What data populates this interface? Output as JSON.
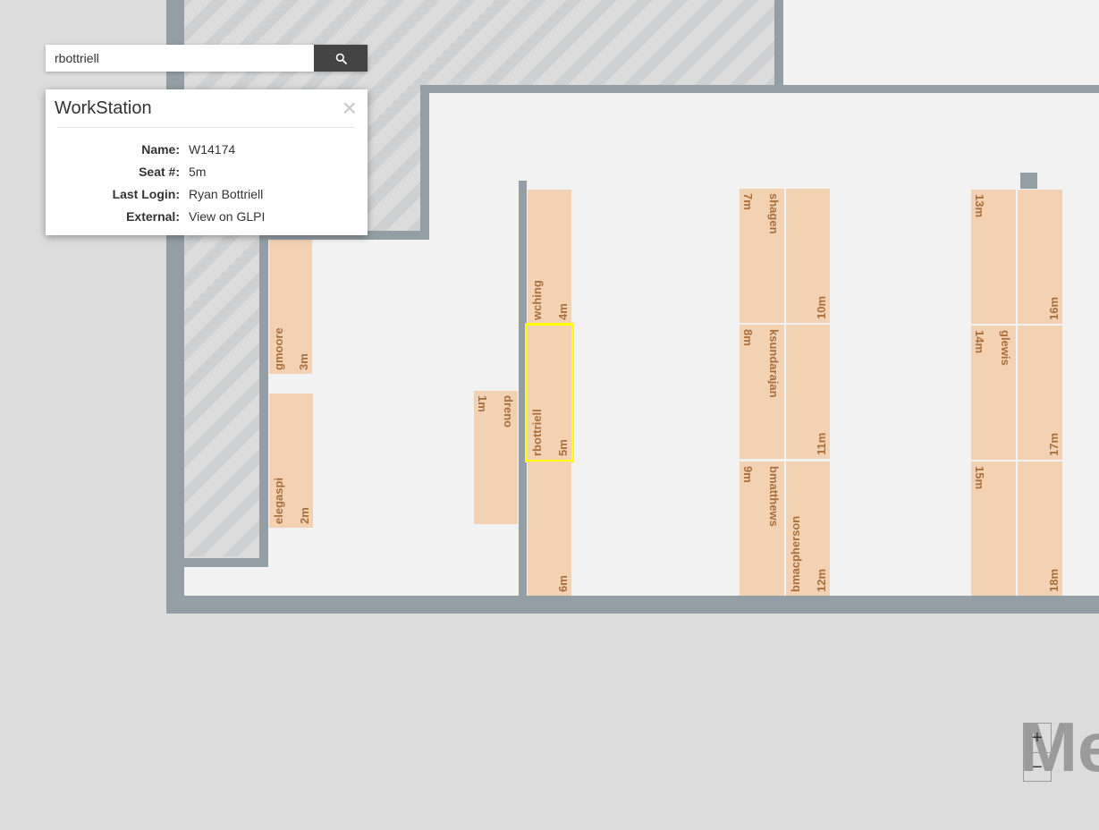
{
  "search": {
    "value": "rbottriell",
    "icon": "search-icon"
  },
  "popup": {
    "title": "WorkStation",
    "close_icon": "close-icon",
    "rows": [
      {
        "key": "Name:",
        "value": "W14174",
        "link": false
      },
      {
        "key": "Seat #:",
        "value": "5m",
        "link": true
      },
      {
        "key": "Last Login:",
        "value": "Ryan Bottriell",
        "link": true
      },
      {
        "key": "External:",
        "value": "View on GLPI",
        "link": true
      }
    ]
  },
  "map": {
    "selected_seat": "5m",
    "selection_color": "#ffff00",
    "desk_color": "#f3d2b3",
    "wall_color": "#949fa5",
    "desks": [
      {
        "seat": "2m",
        "user": "elegaspi"
      },
      {
        "seat": "3m",
        "user": "gmoore"
      },
      {
        "seat": "1m",
        "user": "dreno"
      },
      {
        "seat": "4m",
        "user": "wching"
      },
      {
        "seat": "5m",
        "user": "rbottriell"
      },
      {
        "seat": "6m",
        "user": ""
      },
      {
        "seat": "7m",
        "user": "shagen"
      },
      {
        "seat": "8m",
        "user": "ksundarajan"
      },
      {
        "seat": "9m",
        "user": "bmatthews"
      },
      {
        "seat": "10m",
        "user": ""
      },
      {
        "seat": "11m",
        "user": ""
      },
      {
        "seat": "12m",
        "user": "bmacpherson"
      },
      {
        "seat": "13m",
        "user": ""
      },
      {
        "seat": "14m",
        "user": "glewis"
      },
      {
        "seat": "15m",
        "user": ""
      },
      {
        "seat": "16m",
        "user": ""
      },
      {
        "seat": "17m",
        "user": ""
      },
      {
        "seat": "18m",
        "user": ""
      }
    ]
  },
  "zoom": {
    "in_label": "+",
    "out_label": "−"
  },
  "watermark": "Me"
}
